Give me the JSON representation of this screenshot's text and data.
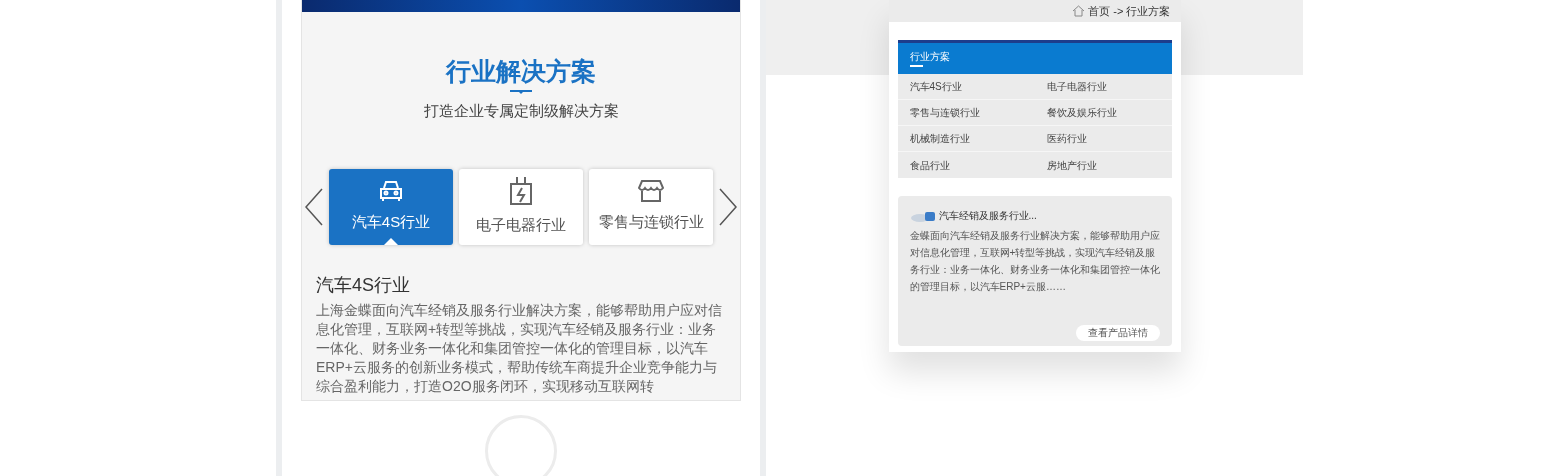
{
  "phone": {
    "section_title": "行业解决方案",
    "section_subtitle": "打造企业专属定制级解决方案",
    "tabs": [
      {
        "label": "汽车4S行业",
        "kind": "car",
        "selected": true
      },
      {
        "label": "电子电器行业",
        "kind": "plug",
        "selected": false
      },
      {
        "label": "零售与连锁行业",
        "kind": "shop",
        "selected": false
      }
    ],
    "detail_title": "汽车4S行业",
    "detail_text": "上海金蝶面向汽车经销及服务行业解决方案，能够帮助用户应对信息化管理，互联网+转型等挑战，实现汽车经销及服务行业：业务一体化、财务业务一体化和集团管控一体化的管理目标，以汽车ERP+云服务的创新业务模式，帮助传统车商提升企业竞争能力与综合盈利能力，打造O2O服务闭环，实现移动互联网转"
  },
  "page": {
    "breadcrumb": "首页 -> 行业方案",
    "banner_title": "行业方案",
    "industries": [
      "汽车4S行业",
      "电子电器行业",
      "零售与连锁行业",
      "餐饮及娱乐行业",
      "机械制造行业",
      "医药行业",
      "食品行业",
      "房地产行业"
    ],
    "product": {
      "title": "汽车经销及服务行业...",
      "text": "金蝶面向汽车经销及服务行业解决方案，能够帮助用户应对信息化管理，互联网+转型等挑战，实现汽车经销及服务行业：业务一体化、财务业务一体化和集团管控一体化的管理目标，以汽车ERP+云服……",
      "button": "查看产品详情"
    }
  }
}
